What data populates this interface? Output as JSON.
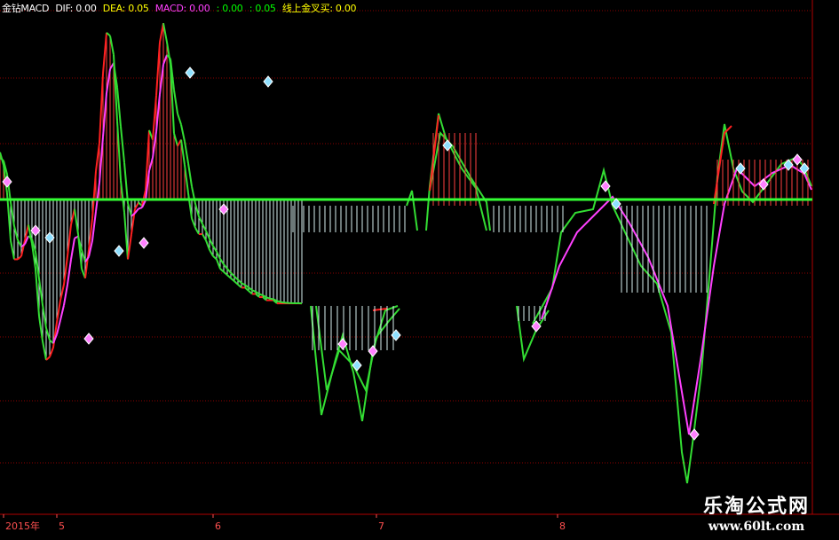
{
  "header": {
    "title": "金钻MACD",
    "dif_label": "DIF: 0.00",
    "dea_label": "DEA: 0.05",
    "macd_label": "MACD: 0.00",
    "v1": ": 0.00",
    "v2": ": 0.05",
    "cross_label": "线上金叉买: 0.00"
  },
  "colors": {
    "background": "#000000",
    "grid": "#8B0000",
    "dif_up": "#FF2020",
    "dif_down": "#33DD33",
    "dea": "#FF40FF",
    "zero_line": "#33FF33",
    "bar_pos": "#FF4040",
    "bar_neg": "#D8F0F0",
    "header_title": "#FFFFFF",
    "header_dif": "#FFFFFF",
    "header_dea": "#FFFF00",
    "header_macd": "#FF40FF",
    "header_v1": "#00FF00",
    "header_v2": "#00FF00",
    "header_cross": "#FFFF00",
    "axis_text": "#FF5050"
  },
  "x_axis": {
    "labels": [
      "2015年",
      "5",
      "6",
      "7",
      "8"
    ]
  },
  "watermark": {
    "title": "乐淘公式网",
    "url": "www.60lt.com"
  },
  "chart_data": {
    "type": "line",
    "ylim": [
      -10,
      6
    ],
    "grid": true,
    "segments": [
      {
        "x": [
          0,
          4,
          8,
          12,
          16,
          20,
          24,
          28,
          32,
          36,
          40,
          44,
          48,
          52,
          56,
          60,
          64,
          68,
          72,
          76,
          80,
          84,
          88,
          92,
          96,
          100,
          104,
          108,
          112,
          116,
          120,
          124,
          128,
          132,
          136,
          140,
          144,
          148,
          152,
          156,
          160,
          164,
          168,
          172,
          176,
          180,
          184,
          188,
          192,
          196,
          200,
          204,
          208,
          212,
          216,
          220,
          224,
          228,
          232,
          236,
          240,
          244,
          248,
          252,
          256,
          260,
          264,
          268,
          272,
          276,
          280,
          284,
          288,
          292,
          296,
          300,
          304,
          308,
          312,
          316,
          320,
          324,
          328,
          332,
          336,
          340
        ],
        "dif": [
          1.5,
          1.1,
          0.2,
          -1.3,
          -1.9,
          -1.9,
          -1.8,
          -1.3,
          -0.8,
          -1.4,
          -2.2,
          -3.7,
          -4.5,
          -5.1,
          -5.0,
          -4.7,
          -3.9,
          -3.2,
          -2.7,
          -1.8,
          -0.8,
          -0.3,
          -1.1,
          -2.2,
          -2.5,
          -1.6,
          -0.6,
          0.9,
          1.8,
          4.0,
          5.3,
          5.2,
          4.6,
          2.5,
          0.6,
          -0.4,
          -1.9,
          -1.1,
          -0.3,
          -0.1,
          -0.2,
          0.3,
          2.2,
          1.9,
          3.3,
          5.0,
          5.6,
          5.0,
          4.3,
          2.1,
          1.7,
          1.9,
          1.1,
          0.2,
          -0.6,
          -0.9,
          -1.1,
          -1.1,
          -1.3,
          -1.6,
          -1.8,
          -1.9,
          -2.2,
          -2.3,
          -2.4,
          -2.5,
          -2.6,
          -2.7,
          -2.8,
          -2.8,
          -2.9,
          -3.0,
          -3.0,
          -3.1,
          -3.1,
          -3.2,
          -3.2,
          -3.2,
          -3.3,
          -3.3,
          -3.3,
          -3.3,
          -3.3,
          -3.3,
          -3.3,
          -3.3
        ]
      }
    ]
  }
}
